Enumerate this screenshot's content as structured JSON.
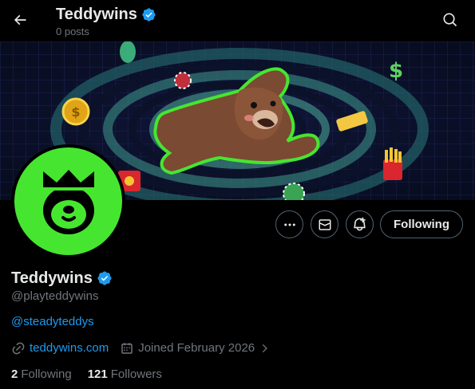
{
  "header": {
    "title": "Teddywins",
    "subtitle": "0 posts"
  },
  "profile": {
    "name": "Teddywins",
    "handle": "@playteddywins",
    "bio_link": "@steadyteddys",
    "website": "teddywins.com",
    "joined": "Joined February 2026"
  },
  "actions": {
    "follow_label": "Following"
  },
  "stats": {
    "following_count": "2",
    "following_label": "Following",
    "followers_count": "121",
    "followers_label": "Followers"
  },
  "colors": {
    "verified": "#1d9bf0",
    "link": "#1d9bf0",
    "brand_green": "#46e630",
    "muted": "#71767b"
  }
}
